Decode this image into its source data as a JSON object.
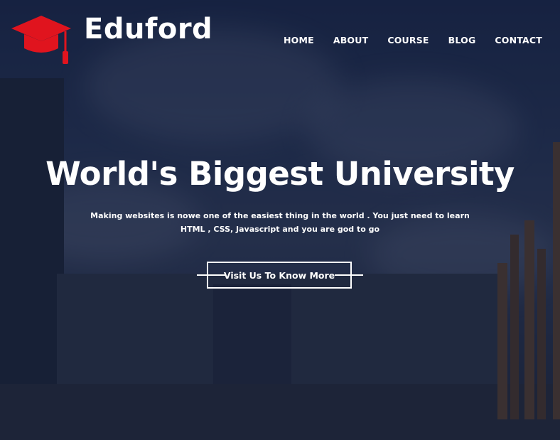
{
  "brand": {
    "name": "Eduford",
    "logo_icon": "graduation-cap-icon",
    "logo_color": "#e0141e"
  },
  "nav": {
    "items": [
      {
        "label": "HOME"
      },
      {
        "label": "ABOUT"
      },
      {
        "label": "COURSE"
      },
      {
        "label": "BLOG"
      },
      {
        "label": "CONTACT"
      }
    ]
  },
  "hero": {
    "title": "World's Biggest University",
    "subtitle": "Making websites is nowe one of the easiest thing in the world . You just need to learn HTML , CSS, Javascript and you are god to go",
    "cta_label": "Visit Us To Know More",
    "overlay_color": "#121c37"
  }
}
